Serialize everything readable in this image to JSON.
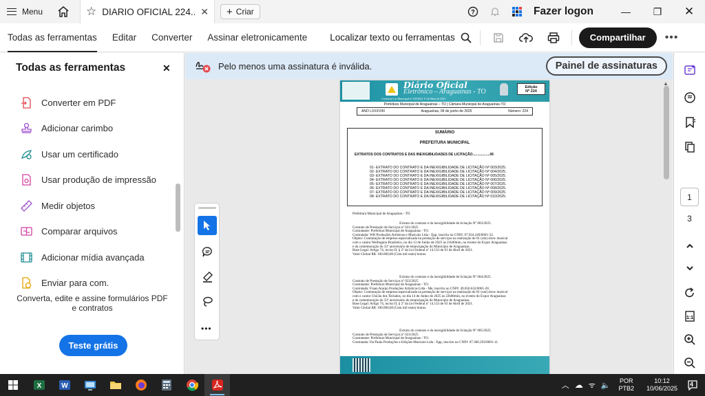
{
  "titlebar": {
    "menu_label": "Menu",
    "tab_title": "DIARIO OFICIAL 224....",
    "create_label": "Criar",
    "login_label": "Fazer logon"
  },
  "toolbar": {
    "tabs": [
      "Todas as ferramentas",
      "Editar",
      "Converter",
      "Assinar eletronicamente"
    ],
    "active_tab": "Todas as ferramentas",
    "find_label": "Localizar texto ou ferramentas",
    "share_label": "Compartilhar"
  },
  "left_panel": {
    "title": "Todas as ferramentas",
    "items": [
      {
        "label": "Converter em PDF",
        "icon": "convert-pdf-icon"
      },
      {
        "label": "Adicionar carimbo",
        "icon": "stamp-icon"
      },
      {
        "label": "Usar um certificado",
        "icon": "certificate-icon"
      },
      {
        "label": "Usar produção de impressão",
        "icon": "print-production-icon"
      },
      {
        "label": "Medir objetos",
        "icon": "ruler-icon"
      },
      {
        "label": "Comparar arquivos",
        "icon": "compare-icon"
      },
      {
        "label": "Adicionar mídia avançada",
        "icon": "media-icon"
      },
      {
        "label": "Enviar para com.",
        "icon": "send-icon"
      }
    ],
    "promo_text": "Converta, edite e assine formulários PDF e contratos",
    "trial_label": "Teste grátis"
  },
  "signature_bar": {
    "message": "Pelo menos uma assinatura é inválida.",
    "panel_button": "Painel de assinaturas"
  },
  "document": {
    "header_title": "Diário Oficial",
    "header_subtitle": "Eletrônico – Araguaínas - TO",
    "header_law": "Conforme Lei Municipal nº 418/2021 17 de Maio de 2021",
    "edition_label": "Edição",
    "edition_number": "Nº 224",
    "org_line": "Prefeitura Municipal de Araguaínas – TO  |  Câmara Municipal de Araguaínas-TO",
    "year": "ANO LXXXVIIII",
    "date": "Araguaínas, 09 de junho de 2025",
    "number": "Número: 224",
    "summary_title": "SUMÁRIO",
    "summary_section": "PREFEITURA MUNICIPAL",
    "summary_heading": "EXTRATOS DOS CONTRATOS E DAS INEXIGIBILIDADES DE LICITAÇÃO..................06",
    "summary_items": [
      "01- EXTRATO DO CONTRATO E DA INEXIGIBILIDADE DE LICITAÇÃO Nº 003/2025.",
      "02- EXTRATO DO CONTRATO E DA INEXIGIBILIDADE DE LICITAÇÃO Nº 004/2025.",
      "03- EXTRATO DO CONTRATO E DA INEXIGIBILIDADE DE LICITAÇÃO Nº 005/2025.",
      "04- EXTRATO DO CONTRATO E DA INEXIGIBILIDADE DE LICITAÇÃO Nº 006/2025.",
      "05- EXTRATO DO CONTRATO E DA INEXIGIBILIDADE DE LICITAÇÃO Nº 007/2025.",
      "06- EXTRATO DO CONTRATO E DA INEXIGIBILIDADE DE LICITAÇÃO Nº 008/2025.",
      "07- EXTRATO DO CONTRATO E DA INEXIGIBILIDADE DE LICITAÇÃO Nº 009/2025.",
      "08- EXTRATO DO CONTRATO E DA INEXIGIBILIDADE DE LICITAÇÃO Nº 010/2025."
    ],
    "body_heading": "Prefeitura Municipal de Araguaínas - TO",
    "extract1": [
      "Extrato do contrato e da inexigibilidade de licitação Nº 003/2025.",
      "Contrato de Prestação de Serviços nº 021/2025",
      "Contratante: Prefeitura Municipal de Araguaínas - TO.",
      "Contratada: WB Produções Artísticas e Musicais Ltda - Epp, inscrito no CNPJ: 07.924.249/0001-32.",
      "Objeto: Contratação de empresa especializada na prestação de serviços na realização de 01 (um) show musical",
      "com o cantor Wellington Brasileiro, no dia 13 de Junho de 2025 às 21h00min, no evento do Expor Araguaínas",
      "e da comemoração do 33º aniversário de emancipação do Município de Araguaínas.",
      "Base Legal: Artigo 74, inciso II, § 2º da Lei Federal nº 14.133 de 01 de Abril de 2021.",
      "Valor Global R$: 100.000,00 (Cem mil reais) brutos."
    ],
    "extract2": [
      "Extrato do contrato e da inexigibilidade de licitação Nº 004/2025.",
      "Contrato de Prestação de Serviços nº 022/2025",
      "Contratante: Prefeitura Municipal de Araguaínas - TO.",
      "Contratada: Fraan Araújo Produções Artísticas Ltda - Me, inscrito no CNPJ: 49.650.632/0001-28.",
      "Objeto: Contratação de empresa especializada na prestação de serviços na realização de 01 (um) show musical",
      "com o cantor Chicão dos Teclados, no dia 14 de Junho de 2025 às 22h00min, no evento do Expor Araguaínas",
      "e da comemoração do 33º aniversário de emancipação do Município de Araguaínas.",
      "Base Legal: Artigo 74, inciso II, § 2º da Lei Federal nº 14.133 de 01 de Abril de 2021.",
      "Valor Global R$: 100.000,00 (Cem mil reais) brutos."
    ],
    "extract3": [
      "Extrato do contrato e da inexigibilidade de licitação Nº 005/2025.",
      "Contrato de Prestação de Serviços nº 023/2025",
      "Contratante: Prefeitura Municipal de Araguaínas - TO.",
      "Contratada: Da Paula Produções e Edições Musicais Ltda - Epp, inscrito no CNPJ: 07.306.293/0001-11."
    ]
  },
  "page_nav": {
    "current": "1",
    "total": "3"
  },
  "taskbar": {
    "lang_top": "POR",
    "lang_bottom": "PTB2",
    "time": "10:12",
    "date": "10/06/2025",
    "notifications": "4"
  }
}
